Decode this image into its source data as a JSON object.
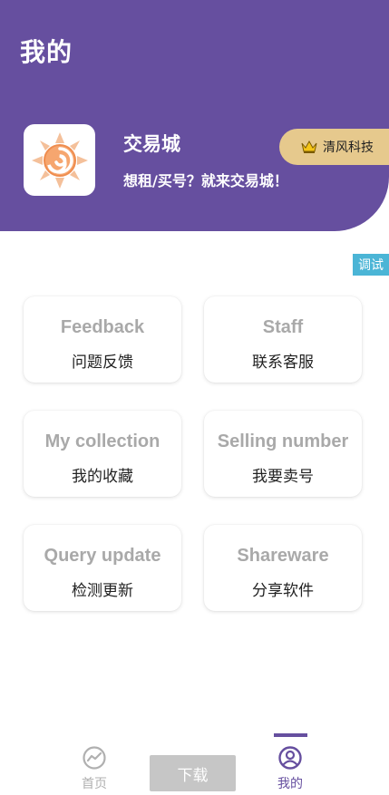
{
  "header": {
    "title": "我的",
    "app_name": "交易城",
    "app_slogan": "想租/买号？就来交易城！",
    "brand_badge": "清风科技",
    "logo_icon": "sun-swirl-logo-icon"
  },
  "debug_tag": "调试",
  "cards": [
    {
      "en": "Feedback",
      "cn": "问题反馈"
    },
    {
      "en": "Staff",
      "cn": "联系客服"
    },
    {
      "en": "My collection",
      "cn": "我的收藏"
    },
    {
      "en": "Selling number",
      "cn": "我要卖号"
    },
    {
      "en": "Query update",
      "cn": "检测更新"
    },
    {
      "en": "Shareware",
      "cn": "分享软件"
    }
  ],
  "bottom_nav": {
    "home_label": "首页",
    "download_label": "下载",
    "mine_label": "我的",
    "active": "我的"
  },
  "colors": {
    "primary": "#664f9f",
    "badge_gold": "#e6c98d",
    "debug_blue": "#4bb5d6",
    "card_title_gray": "#a9a9a9",
    "download_gray": "#c6c6c6"
  }
}
